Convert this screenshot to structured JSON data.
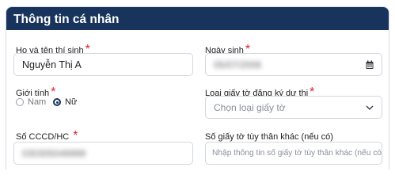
{
  "section": {
    "title": "Thông tin cá nhân"
  },
  "fields": {
    "full_name": {
      "label": "Họ và tên thí sinh",
      "required": "*",
      "value": "Nguyễn Thị A"
    },
    "dob": {
      "label": "Ngày sinh",
      "required": "*",
      "value": "05/07/2006"
    },
    "gender": {
      "label": "Giới tính",
      "required": "*",
      "options": [
        "Nam",
        "Nữ"
      ],
      "selected": "Nữ"
    },
    "id_doc_type": {
      "label": "Loại giấy tờ đăng ký dự thi",
      "required": "*",
      "placeholder": "Chọn loại giấy tờ"
    },
    "id_number": {
      "label": "Số CCCD/HC",
      "required": "*",
      "value": "030305049999"
    },
    "other_id_number": {
      "label": "Số giấy tờ tùy thân khác (nếu có)",
      "placeholder": "Nhập thông tin số giấy tờ tùy thân khác (nếu có)"
    }
  },
  "icons": {
    "calendar": "calendar-icon",
    "dropdown": "chevron-down-icon"
  },
  "colors": {
    "header_bg": "#18335c",
    "required": "#d6262d",
    "border": "#d2d7df"
  }
}
